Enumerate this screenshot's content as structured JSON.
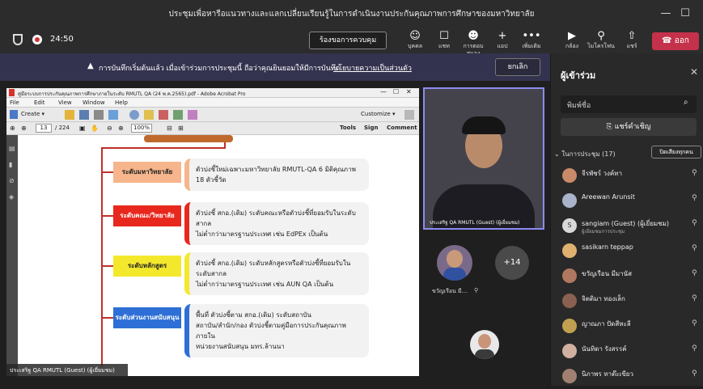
{
  "window": {
    "title": "ประชุมเพื่อหารือแนวทางและแลกเปลี่ยนเรียนรู้ในการดำเนินงานประกันคุณภาพการศึกษาของมหาวิทยาลัย",
    "minimize": "—",
    "restore": "☐",
    "close": "✕"
  },
  "call": {
    "timer": "24:50",
    "request_control": "ร้องขอการควบคุม",
    "tools": [
      {
        "icon": "people-icon",
        "glyph": "☺",
        "label": "บุคคล"
      },
      {
        "icon": "chat-icon",
        "glyph": "☐",
        "label": "แชท"
      },
      {
        "icon": "reactions-icon",
        "glyph": "☻",
        "label": "การตอบสนอง"
      },
      {
        "icon": "apps-icon",
        "glyph": "+",
        "label": "แอป"
      },
      {
        "icon": "more-icon",
        "glyph": "•••",
        "label": "เพิ่มเติม"
      },
      {
        "icon": "camera-off-icon",
        "glyph": "▶",
        "label": "กล้อง"
      },
      {
        "icon": "mic-off-icon",
        "glyph": "⚲",
        "label": "ไมโครโฟน"
      },
      {
        "icon": "share-icon",
        "glyph": "⇧",
        "label": "แชร์"
      }
    ],
    "leave": "ออก",
    "leave_color": "#c4314b"
  },
  "banner": {
    "text": "การบันทึกเริ่มต้นแล้ว เมื่อเข้าร่วมการประชุมนี้ ถือว่าคุณยินยอมให้มีการบันทึก",
    "link": "นโยบายความเป็นส่วนตัว",
    "dismiss": "ยกเลิก"
  },
  "shared": {
    "pdf_title": "คู่มือระบบการประกันคุณภาพการศึกษาภายในระดับ RMUTL QA (24 พ.ค.2565).pdf - Adobe Acrobat Pro",
    "menu": [
      "File",
      "Edit",
      "View",
      "Window",
      "Help"
    ],
    "create": "Create ▾",
    "customize": "Customize ▾",
    "page_current": "13",
    "page_total": "/ 224",
    "zoom": "100%",
    "tools_tab": "Tools",
    "sign_tab": "Sign",
    "comment_tab": "Comment",
    "rows": [
      {
        "label": "ระดับมหาวิทยาลัย",
        "text1": "ตัวบ่งชี้ใหม่เฉพาะมหาวิทยาลัย RMUTL-QA 6 มิติคุณภาพ 18 ตัวชี้วัด",
        "text2": "",
        "color": "#f6b58c"
      },
      {
        "label": "ระดับคณะ/วิทยาลัย",
        "text1": "ตัวบ่งชี้ สกอ.(เดิม) ระดับคณะหรือตัวบ่งชี้ที่ยอมรับในระดับสากล",
        "text2": "ไม่ต่ำกว่ามาตรฐานประเทศ เช่น EdPEx เป็นต้น",
        "color": "#e8271d"
      },
      {
        "label": "ระดับหลักสูตร",
        "text1": "ตัวบ่งชี้ สกอ.(เดิม) ระดับหลักสูตรหรือตัวบ่งชี้ที่ยอมรับในระดับสากล",
        "text2": "ไม่ต่ำกว่ามาตรฐานประเทศ เช่น AUN QA เป็นต้น",
        "color": "#f4e82c"
      },
      {
        "label": "ระดับส่วนงานสนับสนุน",
        "text1": "พื้นที่ ตัวบ่งชี้ตาม สกอ.(เดิม) ระดับสถาบัน",
        "text2": "สถาบัน/สำนัก/กอง ตัวบ่งชี้ตามคู่มือการประกันคุณภาพภายใน",
        "text3": "หน่วยงานสนับสนุน มทร.ล้านนา",
        "color": "#2d6fd6"
      }
    ],
    "presenter_caption": "ประเสริฐ QA RMUTL (Guest) (ผู้เยี่ยมชม)"
  },
  "videos": {
    "main_name": "ประเสริฐ QA RMUTL (Guest) (ผู้เยี่ยมชม)",
    "tile_name": "ขวัญเรือน มี...",
    "overflow": "+14"
  },
  "panel": {
    "title": "ผู้เข้าร่วม",
    "search_placeholder": "พิมพ์ชื่อ",
    "share_invite": "แชร์คำเชิญ",
    "section": "ในการประชุม (17)",
    "mute_all": "ปิดเสียงทุกคน",
    "people": [
      {
        "name": "จีรพัชร์ วงค์ทา",
        "sub": "",
        "color": "#c98a6a"
      },
      {
        "name": "Areewan Arunsit",
        "sub": "",
        "color": "#a9b3c9"
      },
      {
        "name": "sangiam (Guest) (ผู้เยี่ยมชม)",
        "sub": "ผู้เยี่ยมชมการประชุม",
        "color": "#d9d9d9",
        "initial": "S"
      },
      {
        "name": "sasikarn teppap",
        "sub": "",
        "color": "#e0b070"
      },
      {
        "name": "ขวัญเรือน มีมานัส",
        "sub": "",
        "color": "#b07860"
      },
      {
        "name": "จิตติมา ทองเล็ก",
        "sub": "",
        "color": "#8a6050"
      },
      {
        "name": "ญาณภา ปัดสีหะลี",
        "sub": "",
        "color": "#c0a050"
      },
      {
        "name": "นันทิดา รังสรรค์",
        "sub": "",
        "color": "#d0b0a0"
      },
      {
        "name": "นิภาพร ทาต๊ะเขียว",
        "sub": "",
        "color": "#a08070"
      }
    ]
  }
}
